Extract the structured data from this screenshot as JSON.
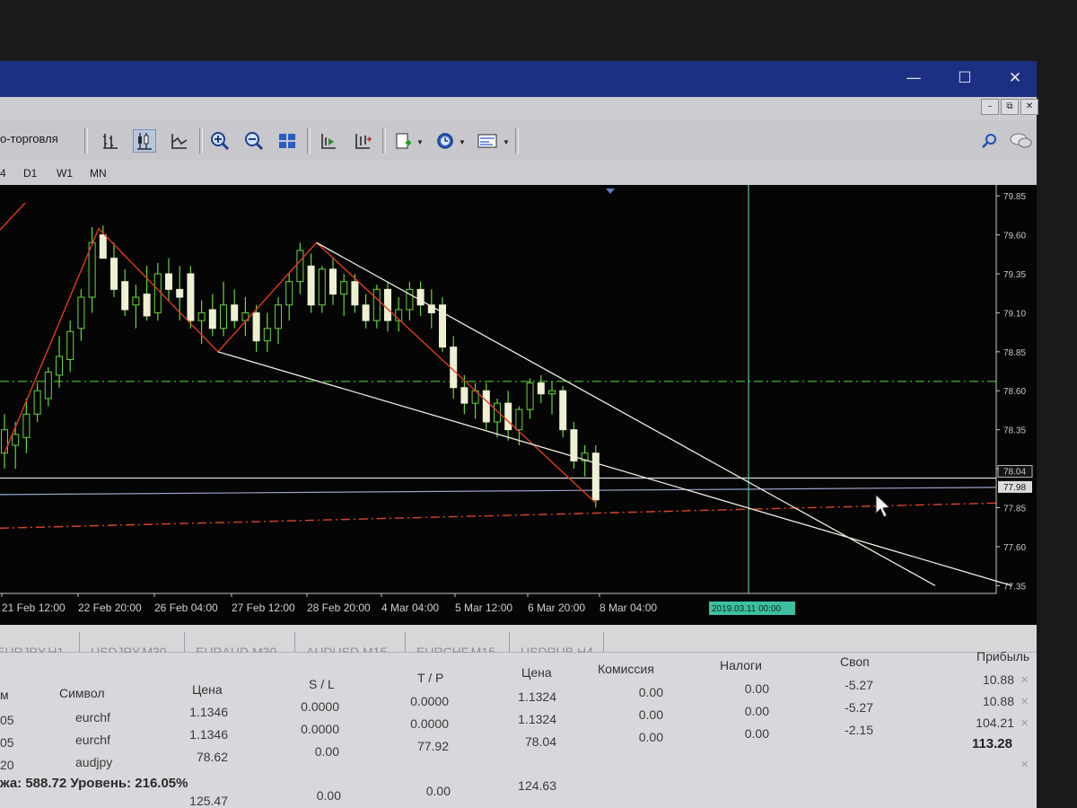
{
  "window": {
    "min_label": "—",
    "max_label": "☐",
    "close_label": "✕",
    "doc_min": "–",
    "doc_restore": "⧉",
    "doc_close": "✕"
  },
  "toolbar": {
    "algo_trading_label": "о-торговля",
    "icons": [
      "bar-chart-icon",
      "candlestick-chart-icon",
      "line-chart-icon",
      "zoom-in-icon",
      "zoom-out-icon",
      "tile-windows-icon",
      "chart-shift-icon",
      "autoscroll-icon",
      "indicators-icon",
      "periods-icon",
      "templates-icon"
    ],
    "search_icon": "search-icon",
    "chat_icon": "chat-icon"
  },
  "timeframes": [
    "4",
    "D1",
    "W1",
    "MN"
  ],
  "chart": {
    "price_axis": [
      "79.85",
      "79.60",
      "79.35",
      "79.10",
      "78.85",
      "78.60",
      "78.35",
      "78.10",
      "77.85",
      "77.60",
      "77.35"
    ],
    "bid_price": "78.04",
    "ask_price": "77.98",
    "time_axis": [
      "21 Feb 12:00",
      "22 Feb 20:00",
      "26 Feb 04:00",
      "27 Feb 12:00",
      "28 Feb 20:00",
      "4 Mar 04:00",
      "5 Mar 12:00",
      "6 Mar 20:00",
      "8 Mar 04:00"
    ],
    "crosshair_time": "2019.03.11 00:00",
    "colors": {
      "background": "#050505",
      "bull_candle": "#efefd2",
      "bear_candle": "#efefd2",
      "wick": "#66d63c",
      "zigzag": "#e23a1c",
      "trendline": "#f0ece0",
      "level_line": "#4fc53a",
      "stop_line": "#e04428",
      "crosshair": "#47c9a8"
    }
  },
  "chart_data": {
    "type": "candlestick",
    "symbol": "",
    "price_range": [
      77.3,
      79.92
    ],
    "candles": [
      {
        "o": 78.2,
        "h": 78.45,
        "l": 78.1,
        "c": 78.35
      },
      {
        "o": 78.25,
        "h": 78.4,
        "l": 78.1,
        "c": 78.32
      },
      {
        "o": 78.3,
        "h": 78.55,
        "l": 78.2,
        "c": 78.45
      },
      {
        "o": 78.45,
        "h": 78.65,
        "l": 78.4,
        "c": 78.6
      },
      {
        "o": 78.55,
        "h": 78.75,
        "l": 78.5,
        "c": 78.72
      },
      {
        "o": 78.7,
        "h": 78.95,
        "l": 78.62,
        "c": 78.82
      },
      {
        "o": 78.8,
        "h": 79.05,
        "l": 78.72,
        "c": 78.98
      },
      {
        "o": 79.0,
        "h": 79.25,
        "l": 78.92,
        "c": 79.2
      },
      {
        "o": 79.2,
        "h": 79.65,
        "l": 79.1,
        "c": 79.55
      },
      {
        "o": 79.6,
        "h": 79.66,
        "l": 79.45,
        "c": 79.45
      },
      {
        "o": 79.45,
        "h": 79.55,
        "l": 79.2,
        "c": 79.25
      },
      {
        "o": 79.3,
        "h": 79.38,
        "l": 79.08,
        "c": 79.12
      },
      {
        "o": 79.15,
        "h": 79.28,
        "l": 79.0,
        "c": 79.2
      },
      {
        "o": 79.22,
        "h": 79.4,
        "l": 79.05,
        "c": 79.08
      },
      {
        "o": 79.1,
        "h": 79.42,
        "l": 79.05,
        "c": 79.35
      },
      {
        "o": 79.35,
        "h": 79.45,
        "l": 79.18,
        "c": 79.25
      },
      {
        "o": 79.25,
        "h": 79.4,
        "l": 79.05,
        "c": 79.2
      },
      {
        "o": 79.35,
        "h": 79.4,
        "l": 79.0,
        "c": 79.05
      },
      {
        "o": 79.05,
        "h": 79.18,
        "l": 78.9,
        "c": 79.1
      },
      {
        "o": 79.12,
        "h": 79.22,
        "l": 78.95,
        "c": 79.0
      },
      {
        "o": 79.0,
        "h": 79.3,
        "l": 78.95,
        "c": 79.15
      },
      {
        "o": 79.15,
        "h": 79.25,
        "l": 79.0,
        "c": 79.05
      },
      {
        "o": 79.05,
        "h": 79.2,
        "l": 78.95,
        "c": 79.1
      },
      {
        "o": 79.1,
        "h": 79.15,
        "l": 78.85,
        "c": 78.92
      },
      {
        "o": 78.92,
        "h": 79.1,
        "l": 78.85,
        "c": 79.0
      },
      {
        "o": 79.0,
        "h": 79.2,
        "l": 78.9,
        "c": 79.15
      },
      {
        "o": 79.15,
        "h": 79.35,
        "l": 79.05,
        "c": 79.3
      },
      {
        "o": 79.3,
        "h": 79.55,
        "l": 79.22,
        "c": 79.5
      },
      {
        "o": 79.4,
        "h": 79.48,
        "l": 79.1,
        "c": 79.15
      },
      {
        "o": 79.15,
        "h": 79.4,
        "l": 79.1,
        "c": 79.38
      },
      {
        "o": 79.38,
        "h": 79.45,
        "l": 79.15,
        "c": 79.22
      },
      {
        "o": 79.22,
        "h": 79.35,
        "l": 79.08,
        "c": 79.3
      },
      {
        "o": 79.3,
        "h": 79.35,
        "l": 79.1,
        "c": 79.15
      },
      {
        "o": 79.15,
        "h": 79.22,
        "l": 79.0,
        "c": 79.05
      },
      {
        "o": 79.05,
        "h": 79.28,
        "l": 79.0,
        "c": 79.25
      },
      {
        "o": 79.25,
        "h": 79.3,
        "l": 78.98,
        "c": 79.05
      },
      {
        "o": 79.05,
        "h": 79.2,
        "l": 78.98,
        "c": 79.12
      },
      {
        "o": 79.12,
        "h": 79.3,
        "l": 79.05,
        "c": 79.25
      },
      {
        "o": 79.25,
        "h": 79.3,
        "l": 79.08,
        "c": 79.15
      },
      {
        "o": 79.15,
        "h": 79.25,
        "l": 79.0,
        "c": 79.1
      },
      {
        "o": 79.15,
        "h": 79.2,
        "l": 78.85,
        "c": 78.88
      },
      {
        "o": 78.88,
        "h": 78.95,
        "l": 78.55,
        "c": 78.62
      },
      {
        "o": 78.62,
        "h": 78.7,
        "l": 78.45,
        "c": 78.52
      },
      {
        "o": 78.52,
        "h": 78.65,
        "l": 78.42,
        "c": 78.6
      },
      {
        "o": 78.6,
        "h": 78.65,
        "l": 78.35,
        "c": 78.4
      },
      {
        "o": 78.4,
        "h": 78.55,
        "l": 78.3,
        "c": 78.52
      },
      {
        "o": 78.52,
        "h": 78.6,
        "l": 78.28,
        "c": 78.35
      },
      {
        "o": 78.35,
        "h": 78.5,
        "l": 78.25,
        "c": 78.48
      },
      {
        "o": 78.48,
        "h": 78.68,
        "l": 78.42,
        "c": 78.65
      },
      {
        "o": 78.65,
        "h": 78.7,
        "l": 78.52,
        "c": 78.58
      },
      {
        "o": 78.58,
        "h": 78.66,
        "l": 78.45,
        "c": 78.6
      },
      {
        "o": 78.6,
        "h": 78.63,
        "l": 78.3,
        "c": 78.35
      },
      {
        "o": 78.35,
        "h": 78.4,
        "l": 78.1,
        "c": 78.15
      },
      {
        "o": 78.15,
        "h": 78.25,
        "l": 78.05,
        "c": 78.2
      },
      {
        "o": 78.2,
        "h": 78.25,
        "l": 77.85,
        "c": 77.9
      }
    ],
    "zigzag": [
      [
        0,
        78.2
      ],
      [
        8.6,
        79.64
      ],
      [
        19.5,
        78.85
      ],
      [
        28.5,
        79.55
      ],
      [
        54,
        77.88
      ]
    ],
    "trendlines": [
      [
        [
          28.5,
          79.55
        ],
        [
          85,
          77.35
        ]
      ],
      [
        [
          19.5,
          78.85
        ],
        [
          92,
          77.35
        ]
      ]
    ],
    "horizontal_levels": {
      "green_dashdot": 78.66,
      "bid": 78.04,
      "ask": 77.98,
      "red_dashdot": 77.88
    },
    "crosshair_time": "2019.03.11 00:00"
  },
  "tabs": [
    "EURJPY,H1",
    "USDJPY,M30",
    "EURAUD,M30",
    "AUDUSD,M15",
    "EURCHF,M15",
    "USDRUB,H4"
  ],
  "terminal": {
    "headers": {
      "col0": "м",
      "symbol": "Символ",
      "price": "Цена",
      "sl": "S / L",
      "tp": "T / P",
      "price2": "Цена",
      "commission": "Комиссия",
      "taxes": "Налоги",
      "swap": "Своп",
      "profit": "Прибыль"
    },
    "rows": [
      {
        "c0": "05",
        "symbol": "eurchf",
        "price": "1.1346",
        "sl": "0.0000",
        "tp": "0.0000",
        "price2": "1.1324",
        "commission": "0.00",
        "taxes": "0.00",
        "swap": "-5.27",
        "profit": "10.88"
      },
      {
        "c0": "05",
        "symbol": "eurchf",
        "price": "1.1346",
        "sl": "0.0000",
        "tp": "0.0000",
        "price2": "1.1324",
        "commission": "0.00",
        "taxes": "0.00",
        "swap": "-5.27",
        "profit": "10.88"
      },
      {
        "c0": "20",
        "symbol": "audjpy",
        "price": "78.62",
        "sl": "0.00",
        "tp": "77.92",
        "price2": "78.04",
        "commission": "0.00",
        "taxes": "0.00",
        "swap": "-2.15",
        "profit": "104.21"
      }
    ],
    "balance_line": "жа: 588.72  Уровень: 216.05%",
    "total_profit": "113.28",
    "pending": {
      "price": "125.47",
      "sl": "0.00",
      "tp": "0.00",
      "price2": "124.63"
    }
  }
}
